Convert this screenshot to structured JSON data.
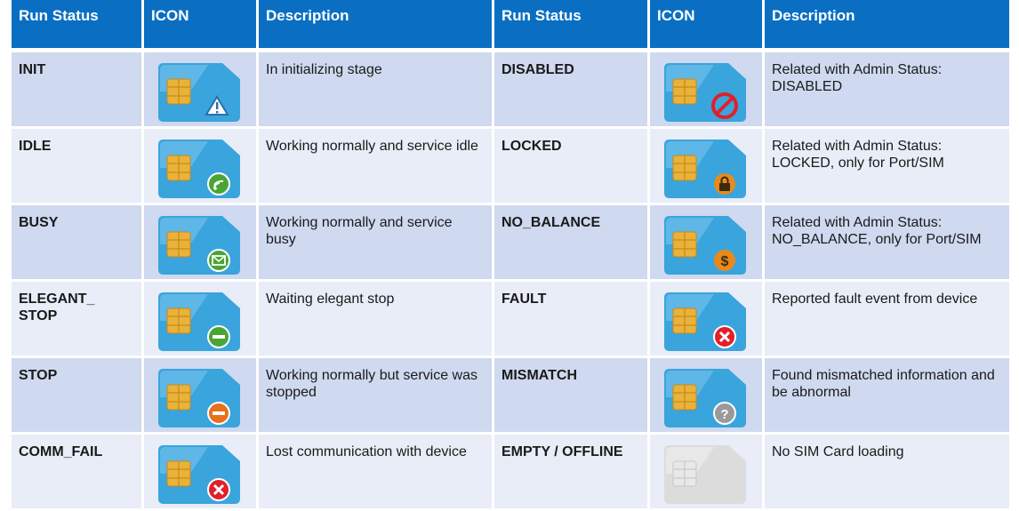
{
  "headers": [
    "Run Status",
    "ICON",
    "Description",
    "Run Status",
    "ICON",
    "Description"
  ],
  "rows": [
    {
      "left": {
        "status": "INIT",
        "icon": "sim-warning-icon",
        "badge": "warning",
        "description": "In initializing stage"
      },
      "right": {
        "status": "DISABLED",
        "icon": "sim-disabled-icon",
        "badge": "prohibited",
        "description": "Related with Admin Status: DISABLED"
      }
    },
    {
      "left": {
        "status": "IDLE",
        "icon": "sim-idle-icon",
        "badge": "idle",
        "description": "Working normally and service idle"
      },
      "right": {
        "status": "LOCKED",
        "icon": "sim-locked-icon",
        "badge": "lock",
        "description": "Related with Admin Status: LOCKED, only for Port/SIM"
      }
    },
    {
      "left": {
        "status": "BUSY",
        "icon": "sim-busy-icon",
        "badge": "busy",
        "description": "Working normally and service busy"
      },
      "right": {
        "status": "NO_BALANCE",
        "icon": "sim-no-balance-icon",
        "badge": "dollar",
        "description": "Related with Admin Status: NO_BALANCE, only for Port/SIM"
      }
    },
    {
      "left": {
        "status": "ELEGANT_ STOP",
        "icon": "sim-elegant-stop-icon",
        "badge": "elegant",
        "description": "Waiting elegant stop"
      },
      "right": {
        "status": "FAULT",
        "icon": "sim-fault-icon",
        "badge": "fault",
        "description": "Reported fault event from device"
      }
    },
    {
      "left": {
        "status": "STOP",
        "icon": "sim-stop-icon",
        "badge": "stop",
        "description": "Working normally but service was stopped"
      },
      "right": {
        "status": "MISMATCH",
        "icon": "sim-mismatch-icon",
        "badge": "question",
        "description": "Found mismatched information and be abnormal"
      }
    },
    {
      "left": {
        "status": "COMM_FAIL",
        "icon": "sim-comm-fail-icon",
        "badge": "fault",
        "description": "Lost communication with device"
      },
      "right": {
        "status": "EMPTY / OFFLINE",
        "icon": "sim-empty-icon",
        "badge": "empty",
        "description": "No SIM Card loading"
      }
    }
  ],
  "colors": {
    "header_bg": "#0a6fc2",
    "row_odd": "#cfd9f0",
    "row_even": "#e8edf8",
    "sim_blue": "#3aa4dc",
    "chip_gold": "#e9b23a"
  }
}
